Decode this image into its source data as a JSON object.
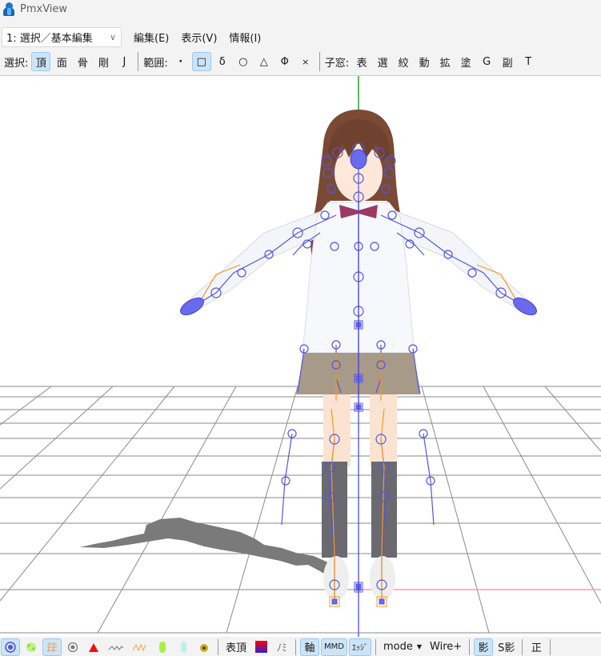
{
  "window": {
    "title": "PmxView",
    "icon": "pmxview-app-icon"
  },
  "menubar": {
    "mode_select": {
      "value": "1: 選択／基本編集",
      "icon": "chevron-down-icon"
    },
    "items": [
      {
        "label": "編集(E)"
      },
      {
        "label": "表示(V)"
      },
      {
        "label": "情報(I)"
      }
    ]
  },
  "toolbar": {
    "select_label": "選択:",
    "select_buttons": [
      {
        "label": "頂",
        "name": "vertex",
        "active": true
      },
      {
        "label": "面",
        "name": "face",
        "active": false
      },
      {
        "label": "骨",
        "name": "bone",
        "active": false
      },
      {
        "label": "剛",
        "name": "rigid-body",
        "active": false
      },
      {
        "label": "J",
        "name": "joint",
        "active": false
      }
    ],
    "range_label": "範囲:",
    "range_buttons": [
      {
        "label": "·",
        "name": "point",
        "active": false
      },
      {
        "label": "□",
        "name": "rectangle",
        "active": true
      },
      {
        "label": "δ",
        "name": "delta",
        "active": false
      },
      {
        "label": "○",
        "name": "circle",
        "active": false
      },
      {
        "label": "△",
        "name": "triangle",
        "active": false
      },
      {
        "label": "Φ",
        "name": "phi",
        "active": false
      },
      {
        "label": "×",
        "name": "clear",
        "active": false
      }
    ],
    "child_window_label": "子窓:",
    "child_window_buttons": [
      {
        "label": "表",
        "name": "table"
      },
      {
        "label": "選",
        "name": "select"
      },
      {
        "label": "絞",
        "name": "filter"
      },
      {
        "label": "動",
        "name": "motion"
      },
      {
        "label": "拡",
        "name": "extend"
      },
      {
        "label": "塗",
        "name": "paint"
      },
      {
        "label": "G",
        "name": "g"
      },
      {
        "label": "副",
        "name": "sub"
      },
      {
        "label": "T",
        "name": "t"
      }
    ]
  },
  "viewport": {
    "colors": {
      "background": "#ffffff",
      "grid": "#7a7a7a",
      "y_axis": "#2e9b2e",
      "x_axis": "#ff9a9a",
      "z_axis": "#4040e0",
      "bone": "#5555dd",
      "bone_ik": "#f59a20",
      "shadow": "#7a7a7a",
      "hair": "#7a4a35",
      "skirt": "#a89a88",
      "sock": "#6a6a70",
      "shirt": "#f7f8fc",
      "skin": "#fbe3d2",
      "ribbon": "#9b3a63"
    }
  },
  "bottombar": {
    "buttons": [
      {
        "name": "show-vertex",
        "icon": "vertex-point-icon",
        "active": true
      },
      {
        "name": "show-weight",
        "icon": "weight-spray-icon",
        "active": false
      },
      {
        "name": "show-texture",
        "icon": "texture-grid-icon",
        "active": true
      },
      {
        "name": "show-bone-point",
        "icon": "point-icon",
        "active": false
      },
      {
        "name": "show-face",
        "icon": "red-triangle-icon",
        "active": false
      },
      {
        "name": "show-wire",
        "icon": "wire-icon",
        "active": false
      },
      {
        "name": "show-wire-color",
        "icon": "wire-orange-icon",
        "active": false
      },
      {
        "name": "show-rigid",
        "icon": "green-capsule-icon",
        "active": false
      },
      {
        "name": "show-rigid-alt",
        "icon": "cyan-capsule-icon",
        "active": false
      },
      {
        "name": "show-joint",
        "icon": "joint-gear-icon",
        "active": false
      }
    ],
    "table_vertex_label": "表頂",
    "color_swatch": {
      "top": "#ff0000",
      "bottom": "#3020d0"
    },
    "normal_label": "ﾉﾐ",
    "axis_label": "軸",
    "mmd_label": "MMD",
    "edge_label": "ｴｯｼﾞ",
    "mode_label": "mode",
    "wire_label": "Wire+",
    "shadow_label": "影",
    "sshadow_label": "S影",
    "front_label": "正"
  }
}
